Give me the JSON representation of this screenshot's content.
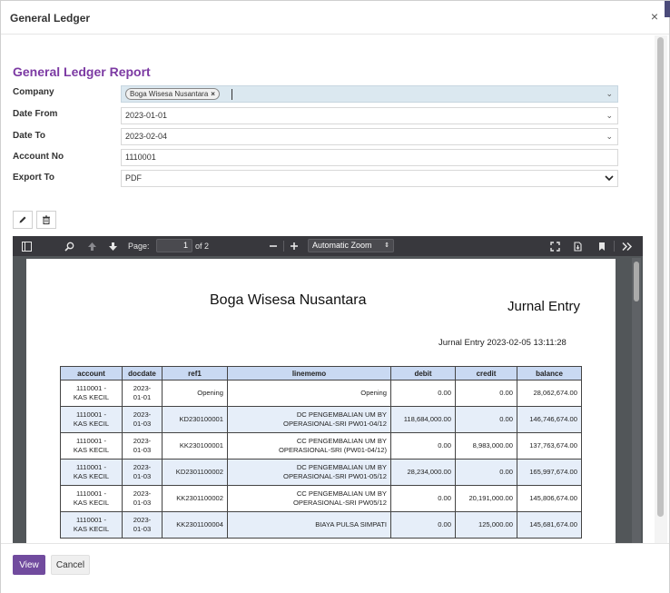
{
  "dialog": {
    "title": "General Ledger",
    "close_glyph": "×"
  },
  "form": {
    "heading": "General Ledger Report",
    "company_label": "Company",
    "company_tag": "Boga Wisesa Nusantara",
    "date_from_label": "Date From",
    "date_from": "2023-01-01",
    "date_to_label": "Date To",
    "date_to": "2023-02-04",
    "account_label": "Account No",
    "account_no": "1110001",
    "export_label": "Export To",
    "export_value": "PDF"
  },
  "viewer": {
    "page_label": "Page:",
    "page_value": "1",
    "page_total": "of 2",
    "zoom": "Automatic Zoom"
  },
  "report": {
    "company": "Boga Wisesa Nusantara",
    "title": "Jurnal Entry",
    "stamp": "Jurnal Entry 2023-02-05 13:11:28",
    "columns": [
      "account",
      "docdate",
      "ref1",
      "linememo",
      "debit",
      "credit",
      "balance"
    ],
    "rows": [
      {
        "account_l1": "1110001 -",
        "account_l2": "KAS KECIL",
        "date_l1": "2023-",
        "date_l2": "01-01",
        "ref": "Opening",
        "memo_l1": "Opening",
        "memo_l2": "",
        "debit": "0.00",
        "credit": "0.00",
        "balance": "28,062,674.00"
      },
      {
        "account_l1": "1110001 -",
        "account_l2": "KAS KECIL",
        "date_l1": "2023-",
        "date_l2": "01-03",
        "ref": "KD230100001",
        "memo_l1": "DC PENGEMBALIAN UM BY",
        "memo_l2": "OPERASIONAL-SRI PW01-04/12",
        "debit": "118,684,000.00",
        "credit": "0.00",
        "balance": "146,746,674.00"
      },
      {
        "account_l1": "1110001 -",
        "account_l2": "KAS KECIL",
        "date_l1": "2023-",
        "date_l2": "01-03",
        "ref": "KK230100001",
        "memo_l1": "CC PENGEMBALIAN UM BY",
        "memo_l2": "OPERASIONAL-SRI (PW01-04/12)",
        "debit": "0.00",
        "credit": "8,983,000.00",
        "balance": "137,763,674.00"
      },
      {
        "account_l1": "1110001 -",
        "account_l2": "KAS KECIL",
        "date_l1": "2023-",
        "date_l2": "01-03",
        "ref": "KD2301100002",
        "memo_l1": "DC PENGEMBALIAN UM BY",
        "memo_l2": "OPERASIONAL-SRI PW01-05/12",
        "debit": "28,234,000.00",
        "credit": "0.00",
        "balance": "165,997,674.00"
      },
      {
        "account_l1": "1110001 -",
        "account_l2": "KAS KECIL",
        "date_l1": "2023-",
        "date_l2": "01-03",
        "ref": "KK2301100002",
        "memo_l1": "CC PENGEMBALIAN UM BY",
        "memo_l2": "OPERASIONAL-SRI PW05/12",
        "debit": "0.00",
        "credit": "20,191,000.00",
        "balance": "145,806,674.00"
      },
      {
        "account_l1": "1110001 -",
        "account_l2": "KAS KECIL",
        "date_l1": "2023-",
        "date_l2": "01-03",
        "ref": "KK2301100004",
        "memo_l1": "BIAYA PULSA SIMPATI",
        "memo_l2": "",
        "debit": "0.00",
        "credit": "125,000.00",
        "balance": "145,681,674.00"
      }
    ]
  },
  "footer": {
    "view_label": "View",
    "cancel_label": "Cancel"
  }
}
